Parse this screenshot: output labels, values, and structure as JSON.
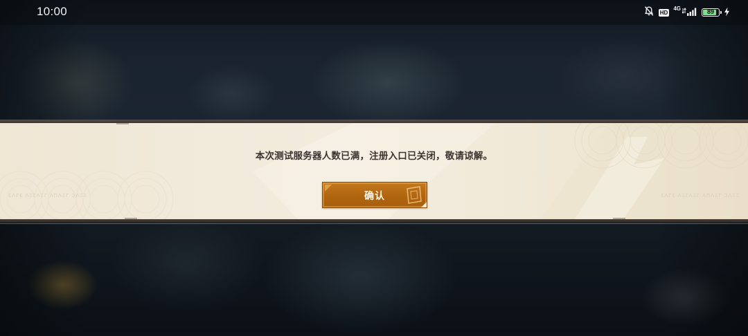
{
  "status_bar": {
    "time": "10:00",
    "icons": [
      "bell-muted-icon",
      "hd-icon",
      "signal-4g-icon",
      "battery-icon",
      "charging-icon"
    ],
    "hd_label": "HD",
    "network_label": "4G",
    "battery_level": "89",
    "battery_fraction": 0.89,
    "battery_color": "#7ee08a"
  },
  "dialog": {
    "message": "本次测试服务器人数已满，注册入口已关闭，敬请谅解。",
    "confirm_label": "确认",
    "side_text_left": "ƐΛΓƐ ΛΞΓΛΞΓ ΛΠΛΞΓ ƆΛΞΞ",
    "side_text_right": "ƐΛΓƐ ΛΞΓΛΞΓ ΛΠΛΞΓ ƆΛΞΞ",
    "colors": {
      "panel": "#f1e9d7",
      "border": "#3a322e",
      "text": "#3b3330",
      "button": "#b0650f",
      "button_text": "#fff6e6"
    }
  }
}
